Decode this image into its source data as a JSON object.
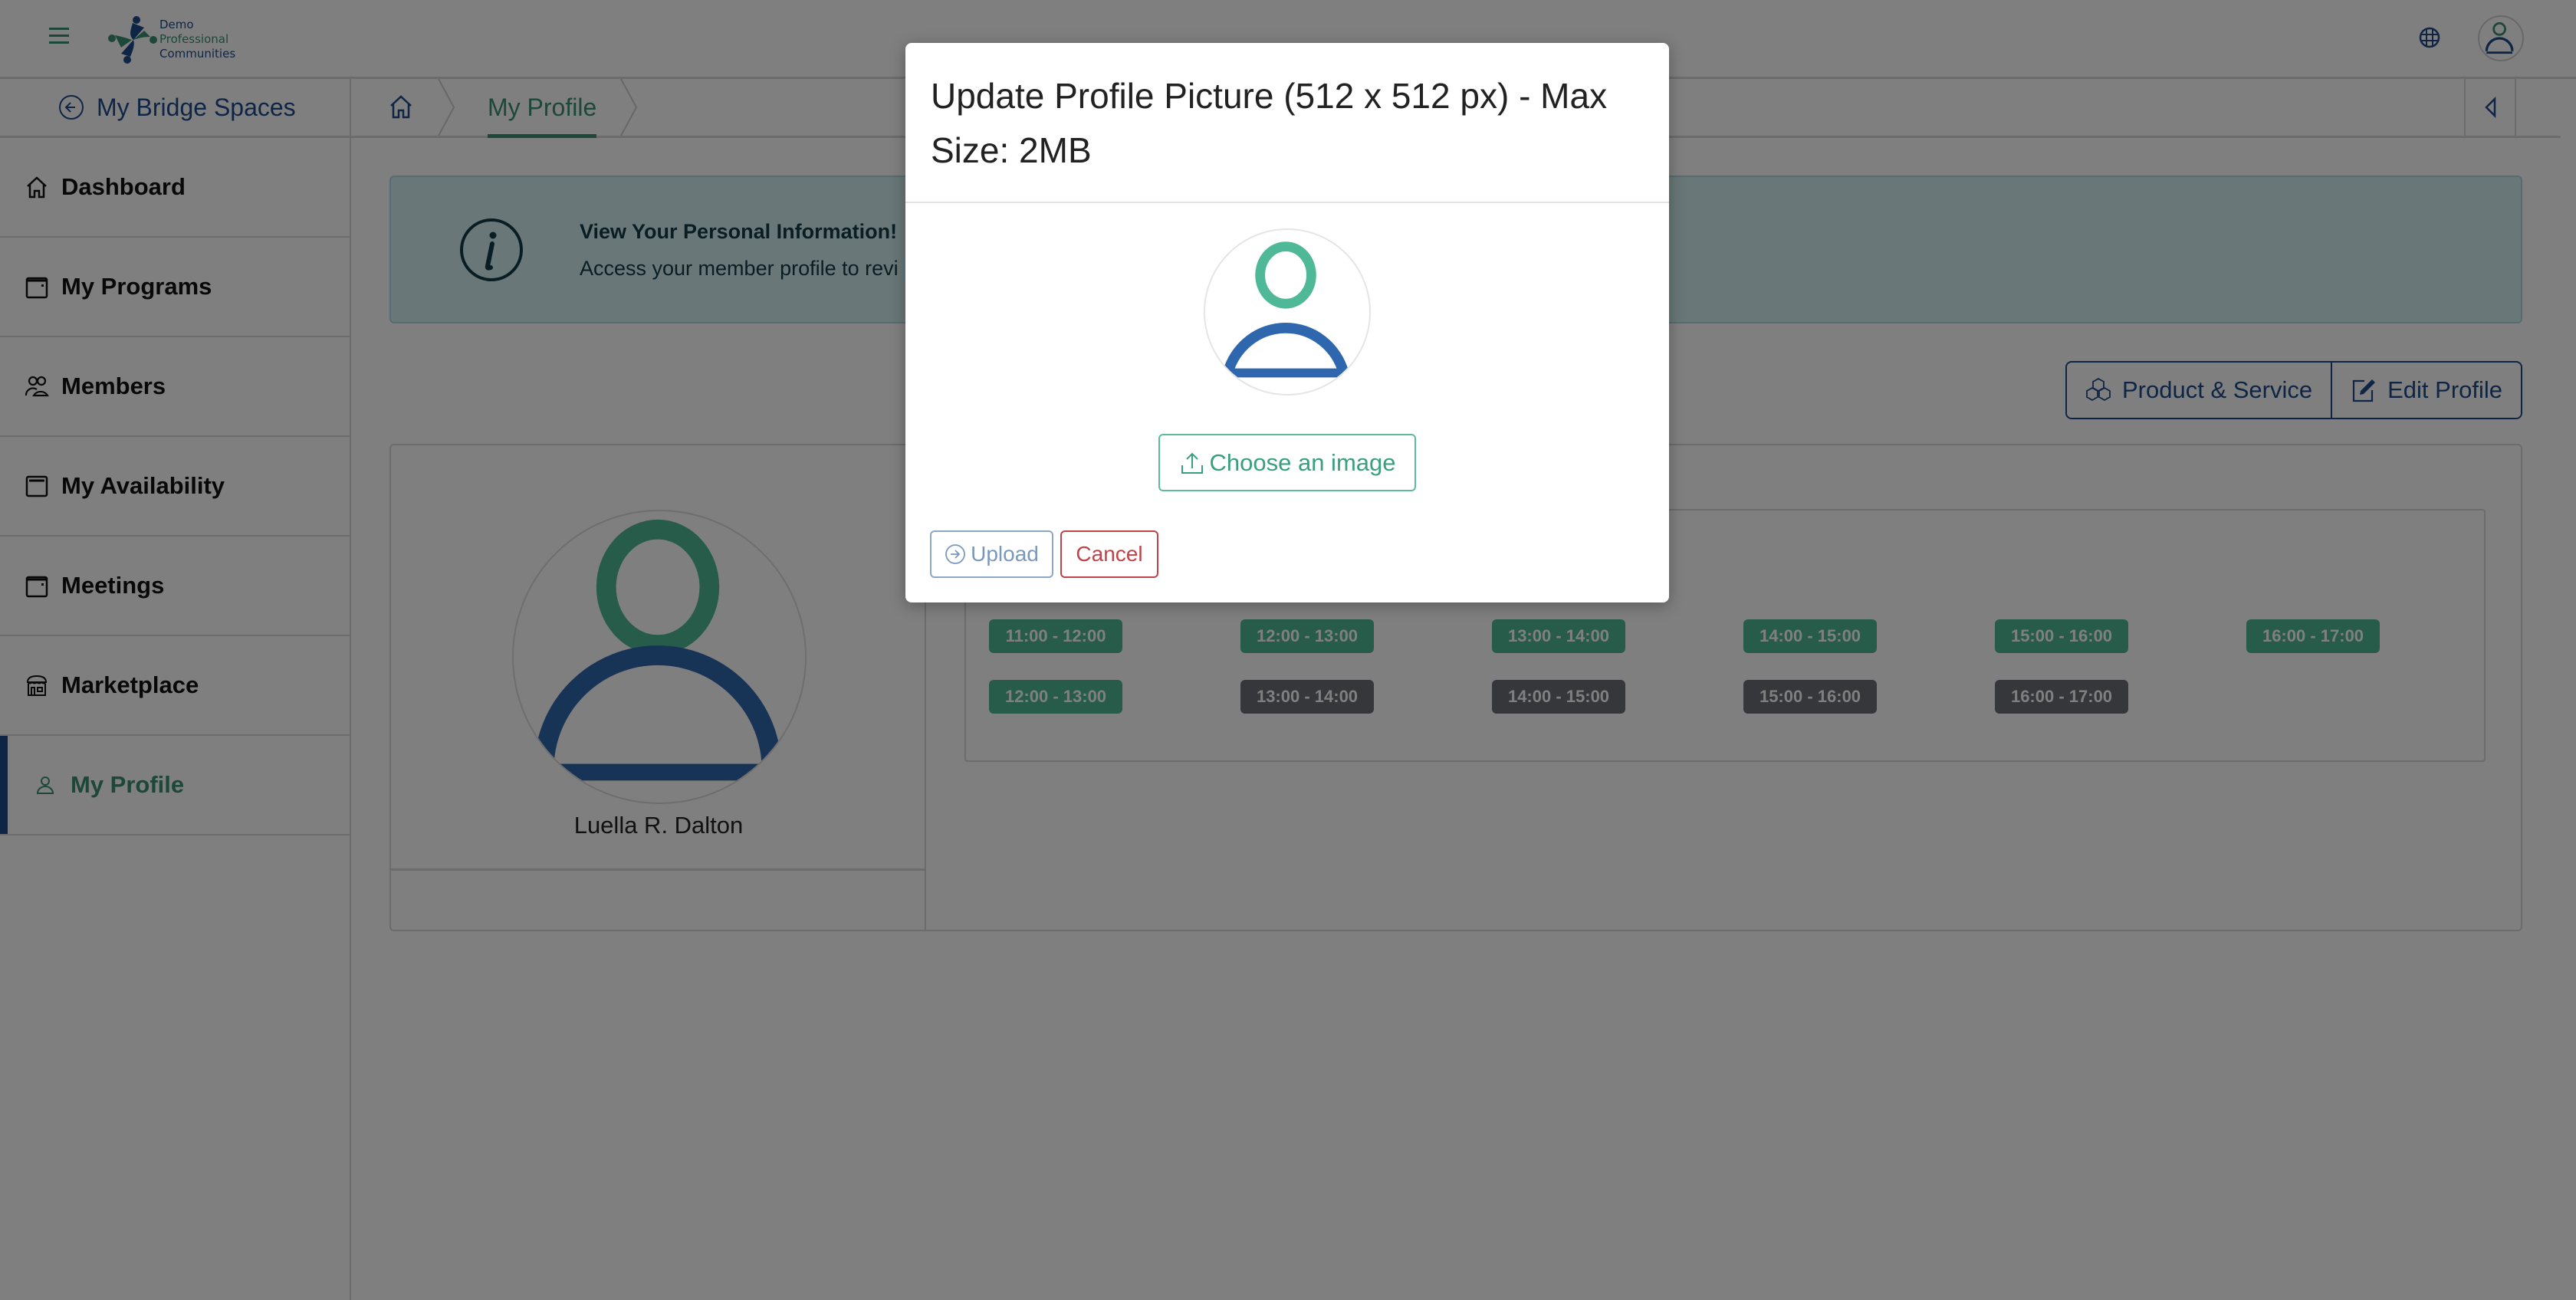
{
  "header": {
    "menu_icon": "hamburger-icon",
    "logo": {
      "line1": "Demo",
      "line2": "Professional",
      "line3": "Communities"
    },
    "language_icon": "globe-icon",
    "account_icon": "user-avatar-icon"
  },
  "breadcrumb": {
    "back_label": "My Bridge Spaces",
    "home_icon": "home-icon",
    "current": "My Profile",
    "collapse_icon": "caret-left-icon"
  },
  "sidebar": {
    "items": [
      {
        "label": "Dashboard",
        "icon": "home-icon",
        "active": false
      },
      {
        "label": "My Programs",
        "icon": "calendar-icon",
        "active": false
      },
      {
        "label": "Members",
        "icon": "users-icon",
        "active": false
      },
      {
        "label": "My Availability",
        "icon": "calendar-icon",
        "active": false
      },
      {
        "label": "Meetings",
        "icon": "calendar-icon",
        "active": false
      },
      {
        "label": "Marketplace",
        "icon": "store-icon",
        "active": false
      },
      {
        "label": "My Profile",
        "icon": "user-icon",
        "active": true
      }
    ]
  },
  "info_banner": {
    "icon": "info-icon",
    "title": "View Your Personal Information!",
    "text": "Access your member profile to revi"
  },
  "actions": {
    "product_service": "Product & Service",
    "edit_profile": "Edit Profile"
  },
  "profile": {
    "name": "Luella R. Dalton"
  },
  "availability": {
    "rows": [
      [
        {
          "label": "11:00 - 12:00",
          "status": "available"
        },
        {
          "label": "12:00 - 13:00",
          "status": "available"
        },
        {
          "label": "13:00 - 14:00",
          "status": "available"
        },
        {
          "label": "14:00 - 15:00",
          "status": "available"
        },
        {
          "label": "15:00 - 16:00",
          "status": "available"
        },
        {
          "label": "16:00 - 17:00",
          "status": "available"
        }
      ],
      [
        {
          "label": "12:00 - 13:00",
          "status": "available"
        },
        {
          "label": "13:00 - 14:00",
          "status": "booked"
        },
        {
          "label": "14:00 - 15:00",
          "status": "booked"
        },
        {
          "label": "15:00 - 16:00",
          "status": "booked"
        },
        {
          "label": "16:00 - 17:00",
          "status": "booked"
        }
      ]
    ]
  },
  "modal": {
    "title": "Update Profile Picture (512 x 512 px) - Max Size: 2MB",
    "choose_label": "Choose an image",
    "upload_label": "Upload",
    "cancel_label": "Cancel"
  },
  "colors": {
    "brand_blue": "#1e4a8a",
    "brand_green": "#3a8f73",
    "slot_available": "#4fb896",
    "slot_booked": "#6b6e76",
    "cancel_red": "#c0434b",
    "info_bg": "#d2eef0"
  }
}
